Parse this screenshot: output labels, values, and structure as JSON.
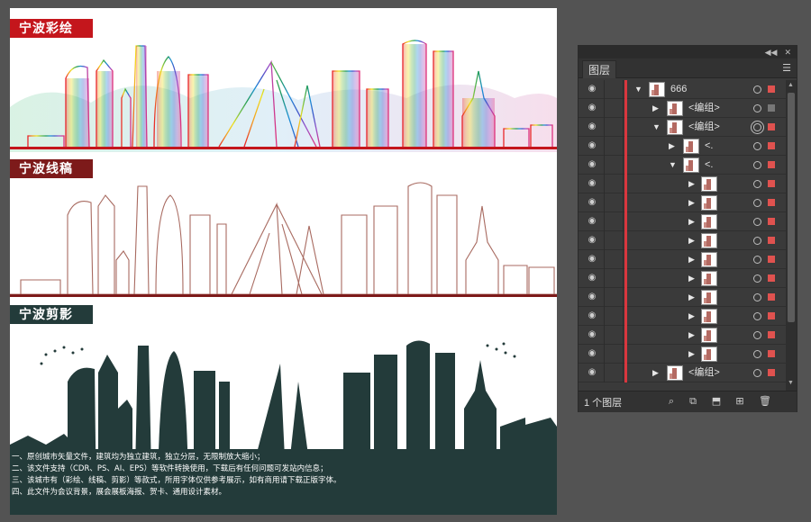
{
  "artboard": {
    "banners": {
      "color": "宁波彩绘",
      "line": "宁波线稿",
      "silhouette": "宁波剪影"
    },
    "notes": [
      "一、原创城市矢量文件，建筑均为独立建筑，独立分层，无限制放大缩小；",
      "二、该文件支持（CDR、PS、AI、EPS）等软件转换使用，下载后有任何问题可发站内信息；",
      "三、该城市有（彩绘、线稿、剪影）等款式，所用字体仅供参考展示，如有商用请下载正版字体。",
      "四、此文件为会议背景，展会展板海报、贺卡、通用设计素材。"
    ],
    "colors": {
      "red": "#c4161c",
      "maroon": "#7d1a1a",
      "dark_teal": "#233b3a"
    }
  },
  "layers_panel": {
    "tab_label": "图层",
    "footer_count": "1 个图层",
    "rows": [
      {
        "label": "666",
        "arrow": "▼",
        "level": 0,
        "target": "single",
        "sel": "red"
      },
      {
        "label": "<编组>",
        "arrow": "▶",
        "level": 1,
        "target": "single",
        "sel": "gray"
      },
      {
        "label": "<编组>",
        "arrow": "▼",
        "level": 1,
        "target": "double",
        "sel": "red"
      },
      {
        "label": "<.",
        "arrow": "▶",
        "level": 2,
        "target": "single",
        "sel": "red"
      },
      {
        "label": "<.",
        "arrow": "▼",
        "level": 2,
        "target": "single",
        "sel": "red"
      },
      {
        "label": "",
        "arrow": "▶",
        "level": 3,
        "target": "single",
        "sel": "red"
      },
      {
        "label": "",
        "arrow": "▶",
        "level": 3,
        "target": "single",
        "sel": "red"
      },
      {
        "label": "",
        "arrow": "▶",
        "level": 3,
        "target": "single",
        "sel": "red"
      },
      {
        "label": "",
        "arrow": "▶",
        "level": 3,
        "target": "single",
        "sel": "red"
      },
      {
        "label": "",
        "arrow": "▶",
        "level": 3,
        "target": "single",
        "sel": "red"
      },
      {
        "label": "",
        "arrow": "▶",
        "level": 3,
        "target": "single",
        "sel": "red"
      },
      {
        "label": "",
        "arrow": "▶",
        "level": 3,
        "target": "single",
        "sel": "red"
      },
      {
        "label": "",
        "arrow": "▶",
        "level": 3,
        "target": "single",
        "sel": "red"
      },
      {
        "label": "",
        "arrow": "▶",
        "level": 3,
        "target": "single",
        "sel": "red"
      },
      {
        "label": "",
        "arrow": "▶",
        "level": 3,
        "target": "single",
        "sel": "red"
      },
      {
        "label": "<编组>",
        "arrow": "▶",
        "level": 1,
        "target": "single",
        "sel": "red"
      }
    ]
  }
}
